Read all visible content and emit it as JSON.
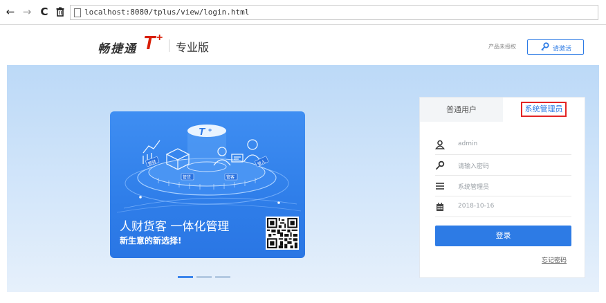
{
  "browser": {
    "url": "localhost:8080/tplus/view/login.html",
    "back_icon": "arrow-left-icon",
    "forward_icon": "arrow-right-icon",
    "reload_icon": "reload-icon",
    "trash_icon": "trash-icon"
  },
  "header": {
    "logo_text": "畅捷通",
    "logo_t": "T",
    "logo_plus": "+",
    "edition": "专业版",
    "auth_status": "产品未授权",
    "activate_label": "请激活",
    "activate_icon": "key-icon"
  },
  "banner": {
    "art_labels": [
      "管财",
      "管货",
      "管客",
      "管人"
    ],
    "art_logo_t": "T",
    "art_logo_plus": "+",
    "title": "人财货客 一体化管理",
    "subtitle": "新生意的新选择!",
    "dots_count": 3,
    "active_dot": 0
  },
  "login": {
    "tab_normal": "普通用户",
    "tab_admin": "系统管理员",
    "username": "admin",
    "password_placeholder": "请输入密码",
    "role": "系统管理员",
    "date": "2018-10-16",
    "login_button": "登录",
    "forgot_password": "忘记密码"
  },
  "colors": {
    "accent": "#2d7be5",
    "brand_red": "#d81e06",
    "highlight_border": "#e32424"
  }
}
